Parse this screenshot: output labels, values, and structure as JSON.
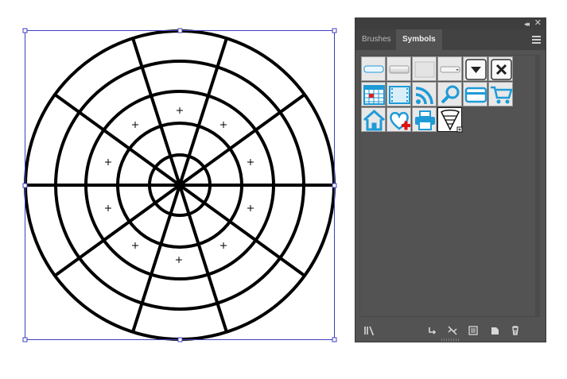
{
  "panel": {
    "tabs": [
      {
        "label": "Brushes",
        "active": false
      },
      {
        "label": "Symbols",
        "active": true
      }
    ],
    "collapse_icon": "double-chevron-icon",
    "close_icon": "close-icon",
    "menu_icon": "panel-menu-icon"
  },
  "symbols": [
    {
      "name": "button-flat-blue",
      "icon": "button-icon"
    },
    {
      "name": "button-gradient",
      "icon": "button-icon"
    },
    {
      "name": "button-plain",
      "icon": "button-icon"
    },
    {
      "name": "button-dropdown-small",
      "icon": "button-icon"
    },
    {
      "name": "dropdown-arrow",
      "icon": "chevron-down-icon"
    },
    {
      "name": "close-x",
      "icon": "close-icon"
    },
    {
      "name": "calendar",
      "icon": "calendar-icon"
    },
    {
      "name": "film",
      "icon": "film-icon"
    },
    {
      "name": "rss",
      "icon": "rss-icon"
    },
    {
      "name": "search",
      "icon": "search-icon"
    },
    {
      "name": "credit-card",
      "icon": "credit-card-icon"
    },
    {
      "name": "shopping-cart",
      "icon": "cart-icon"
    },
    {
      "name": "home",
      "icon": "home-icon"
    },
    {
      "name": "heart-plus",
      "icon": "heart-plus-icon"
    },
    {
      "name": "printer",
      "icon": "printer-icon"
    },
    {
      "name": "cone-segment",
      "icon": "cone-icon",
      "selected": true
    }
  ],
  "footer_icons": [
    "symbol-libraries-icon",
    "place-symbol-icon",
    "break-link-icon",
    "symbol-options-icon",
    "new-symbol-icon",
    "delete-icon"
  ],
  "colors": {
    "panel_bg": "#535353",
    "tab_bg": "#424242",
    "symbol_blue": "#1e9bd7",
    "selection_blue": "#3f3fbf",
    "stroke": "#000000"
  }
}
